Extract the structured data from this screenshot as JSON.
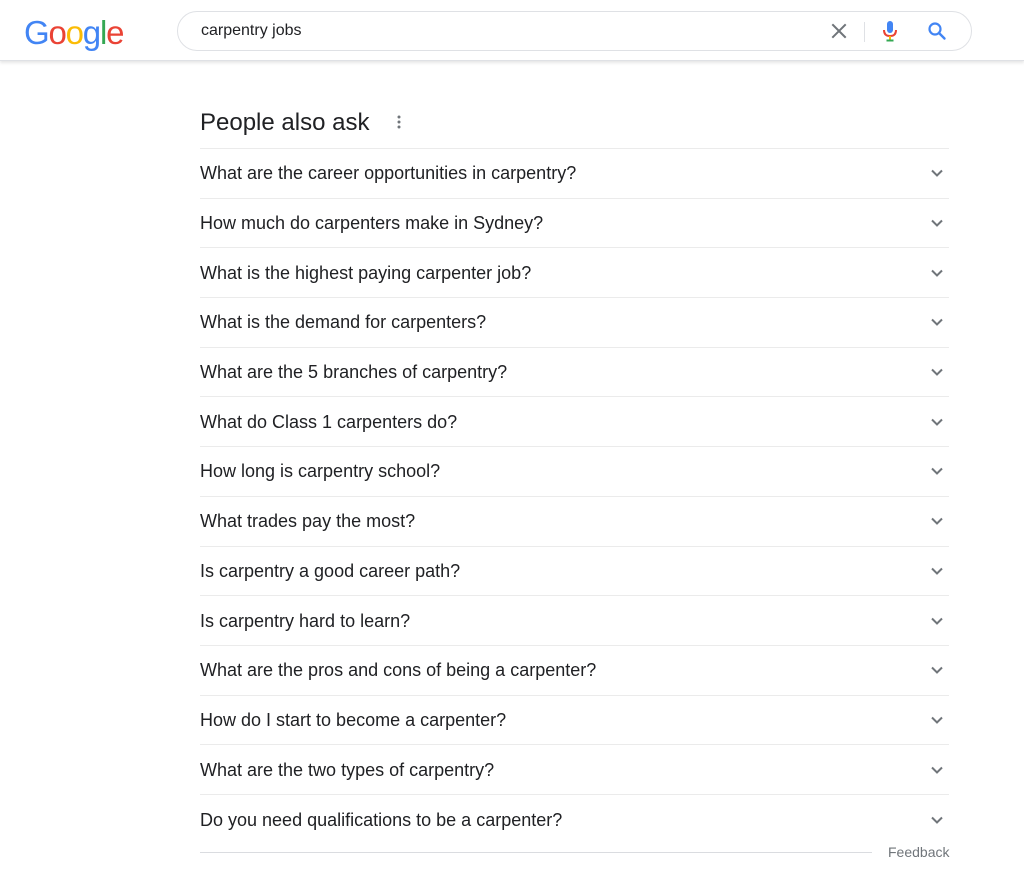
{
  "header": {
    "logo_letters": [
      {
        "char": "G",
        "color": "#4285F4"
      },
      {
        "char": "o",
        "color": "#EA4335"
      },
      {
        "char": "o",
        "color": "#FBBC05"
      },
      {
        "char": "g",
        "color": "#4285F4"
      },
      {
        "char": "l",
        "color": "#34A853"
      },
      {
        "char": "e",
        "color": "#EA4335"
      }
    ],
    "search_query": "carpentry jobs",
    "icons": {
      "clear": "close-icon",
      "voice": "microphone-icon",
      "search": "search-icon"
    }
  },
  "paa": {
    "heading": "People also ask",
    "questions": [
      "What are the career opportunities in carpentry?",
      "How much do carpenters make in Sydney?",
      "What is the highest paying carpenter job?",
      "What is the demand for carpenters?",
      "What are the 5 branches of carpentry?",
      "What do Class 1 carpenters do?",
      "How long is carpentry school?",
      "What trades pay the most?",
      "Is carpentry a good career path?",
      "Is carpentry hard to learn?",
      "What are the pros and cons of being a carpenter?",
      "How do I start to become a carpenter?",
      "What are the two types of carpentry?",
      "Do you need qualifications to be a carpenter?"
    ]
  },
  "footer": {
    "feedback_label": "Feedback"
  },
  "colors": {
    "text": "#202124",
    "muted": "#70757a",
    "divider": "#ebebeb",
    "chevron": "#70757a"
  }
}
